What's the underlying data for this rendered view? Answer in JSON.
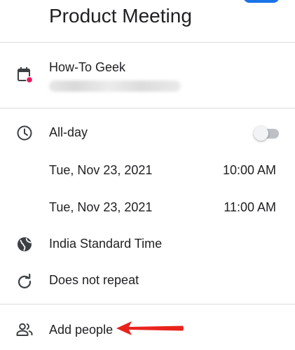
{
  "event": {
    "title": "Product Meeting"
  },
  "calendar": {
    "account_name": "How-To Geek",
    "icon": "calendar-icon",
    "dot_color": "#e8175d"
  },
  "schedule": {
    "all_day_label": "All-day",
    "all_day_enabled": false,
    "start_date": "Tue, Nov 23, 2021",
    "start_time": "10:00 AM",
    "end_date": "Tue, Nov 23, 2021",
    "end_time": "11:00 AM",
    "timezone": "India Standard Time",
    "repeat": "Does not repeat"
  },
  "people": {
    "add_label": "Add people"
  },
  "annotation": {
    "arrow_color": "#e8231e"
  },
  "colors": {
    "accent": "#1a73e8",
    "icon": "#3c4043"
  }
}
